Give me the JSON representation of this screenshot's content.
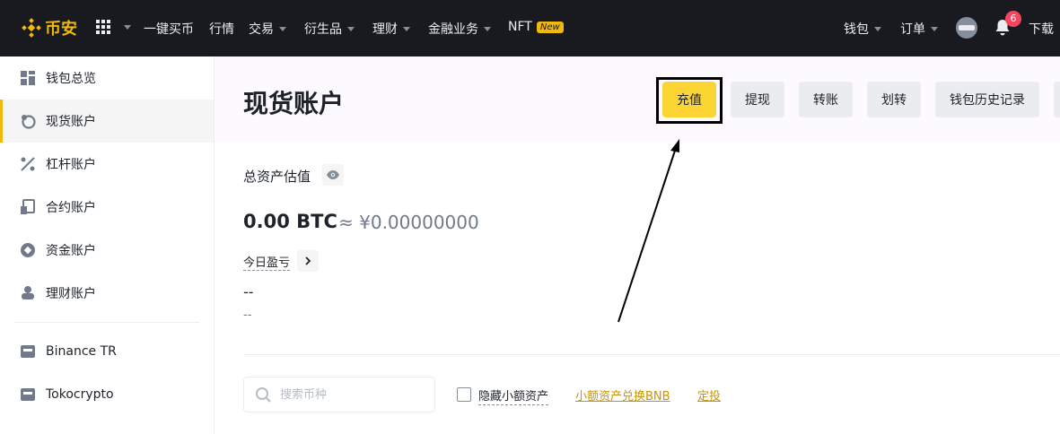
{
  "nav": {
    "logo_text": "币安",
    "items": [
      {
        "label": "一键买币"
      },
      {
        "label": "行情"
      },
      {
        "label": "交易"
      },
      {
        "label": "衍生品"
      },
      {
        "label": "理财"
      },
      {
        "label": "金融业务"
      },
      {
        "label": "NFT",
        "badge": "New"
      }
    ],
    "right": {
      "wallet": "钱包",
      "orders": "订单",
      "notification_count": "6",
      "download": "下载"
    }
  },
  "sidebar": {
    "items": [
      {
        "label": "钱包总览",
        "icon": "dashboard-icon"
      },
      {
        "label": "现货账户",
        "icon": "spot-icon",
        "active": true
      },
      {
        "label": "杠杆账户",
        "icon": "margin-icon"
      },
      {
        "label": "合约账户",
        "icon": "futures-icon"
      },
      {
        "label": "资金账户",
        "icon": "funding-icon"
      },
      {
        "label": "理财账户",
        "icon": "earn-icon"
      },
      {
        "label": "Binance TR",
        "icon": "wallet-icon"
      },
      {
        "label": "Tokocrypto",
        "icon": "wallet-icon"
      }
    ]
  },
  "main": {
    "title": "现货账户",
    "actions": {
      "deposit": "充值",
      "withdraw": "提现",
      "transfer_send": "转账",
      "transfer": "划转",
      "history": "钱包历史记录"
    },
    "balance": {
      "label": "总资产估值",
      "btc": "0.00 BTC",
      "fiat": "≈ ¥0.00000000"
    },
    "pnl": {
      "label": "今日盈亏",
      "value": "--",
      "sub": "--"
    },
    "filters": {
      "search_placeholder": "搜索币种",
      "hide_small": "隐藏小额资产",
      "convert_link": "小额资产兑换BNB",
      "invest_link": "定投"
    }
  },
  "colors": {
    "brand": "#f0b90b",
    "topbar_bg": "#181a20",
    "primary_button": "#fcd535",
    "link": "#c99400",
    "badge": "#f6465d"
  }
}
